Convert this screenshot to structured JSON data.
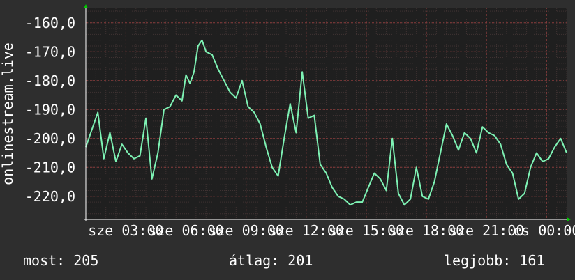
{
  "chart_data": {
    "type": "line",
    "ylabel": "onlinestream.live",
    "ylim": [
      -228,
      -155
    ],
    "ytick_labels": [
      "-160,0",
      "-170,0",
      "-180,0",
      "-190,0",
      "-200,0",
      "-210,0",
      "-220,0"
    ],
    "ytick_values": [
      -160,
      -170,
      -180,
      -190,
      -200,
      -210,
      -220
    ],
    "xtick_labels": [
      "sze 03:00",
      "sze 06:00",
      "sze 09:00",
      "sze 12:00",
      "sze 15:00",
      "sze 18:00",
      "sze 21:00",
      "cs 00:00"
    ],
    "xtick_hours": [
      3,
      6,
      9,
      12,
      15,
      18,
      21,
      24
    ],
    "xlim_hours": [
      1.0,
      25.0
    ],
    "grid": true,
    "series": [
      {
        "x": [
          1.0,
          1.3,
          1.6,
          1.9,
          2.2,
          2.5,
          2.8,
          3.1,
          3.4,
          3.7,
          4.0,
          4.3,
          4.6,
          4.9,
          5.2,
          5.5,
          5.8,
          6.0,
          6.2,
          6.4,
          6.6,
          6.8,
          7.0,
          7.3,
          7.6,
          7.9,
          8.2,
          8.5,
          8.8,
          9.1,
          9.4,
          9.7,
          10.0,
          10.3,
          10.6,
          10.9,
          11.2,
          11.5,
          11.8,
          12.1,
          12.4,
          12.7,
          13.0,
          13.3,
          13.6,
          13.9,
          14.2,
          14.5,
          14.8,
          15.1,
          15.4,
          15.7,
          16.0,
          16.3,
          16.6,
          16.9,
          17.2,
          17.5,
          17.8,
          18.1,
          18.4,
          18.7,
          19.0,
          19.3,
          19.6,
          19.9,
          20.2,
          20.5,
          20.8,
          21.1,
          21.4,
          21.7,
          22.0,
          22.3,
          22.6,
          22.9,
          23.2,
          23.5,
          23.8,
          24.1,
          24.4,
          24.7,
          25.0
        ],
        "y": [
          -203,
          -197,
          -191,
          -207,
          -198,
          -208,
          -202,
          -205,
          -207,
          -206,
          -193,
          -214,
          -205,
          -190,
          -189,
          -185,
          -187,
          -178,
          -181,
          -177,
          -168,
          -166,
          -170,
          -171,
          -176,
          -180,
          -184,
          -186,
          -180,
          -189,
          -191,
          -195,
          -203,
          -210,
          -213,
          -200,
          -188,
          -198,
          -177,
          -193,
          -192,
          -209,
          -212,
          -217,
          -220,
          -221,
          -223,
          -222,
          -222,
          -217,
          -212,
          -214,
          -218,
          -200,
          -219,
          -223,
          -221,
          -210,
          -220,
          -221,
          -215,
          -205,
          -195,
          -199,
          -204,
          -198,
          -200,
          -205,
          -196,
          -198,
          -199,
          -202,
          -209,
          -212,
          -221,
          -219,
          -210,
          -205,
          -208,
          -207,
          -203,
          -200,
          -205
        ]
      }
    ]
  },
  "stats": {
    "now": "most: 205",
    "avg": "átlag: 201",
    "best": "legjobb: 161"
  },
  "colors": {
    "background": "#2e2e2e",
    "plot_background": "#1f1f1f",
    "line": "#7ef2b4",
    "grid": "#5a4242",
    "text": "#ffffff",
    "arrow": "#00cc00"
  }
}
